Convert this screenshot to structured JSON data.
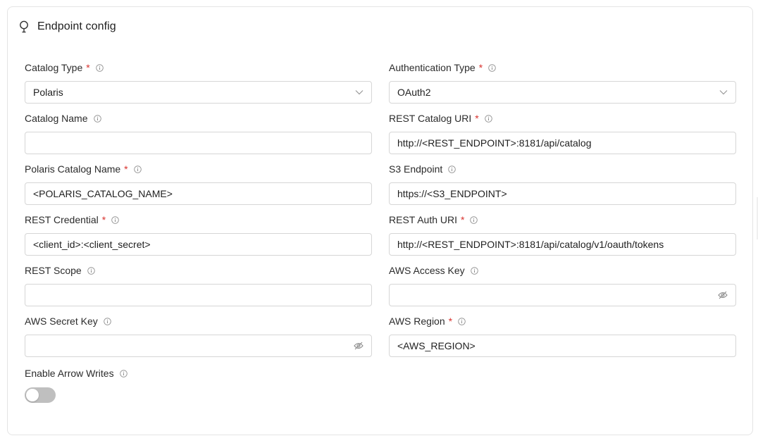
{
  "header": {
    "title": "Endpoint config",
    "icon": "lightbulb-icon"
  },
  "fields": {
    "catalog_type": {
      "label": "Catalog Type",
      "required": "*",
      "value": "Polaris"
    },
    "auth_type": {
      "label": "Authentication Type",
      "required": "*",
      "value": "OAuth2"
    },
    "catalog_name": {
      "label": "Catalog Name",
      "value": ""
    },
    "rest_catalog_uri": {
      "label": "REST Catalog URI",
      "required": "*",
      "value": "http://<REST_ENDPOINT>:8181/api/catalog"
    },
    "polaris_catalog_name": {
      "label": "Polaris Catalog Name",
      "required": "*",
      "value": "<POLARIS_CATALOG_NAME>"
    },
    "s3_endpoint": {
      "label": "S3 Endpoint",
      "value": "https://<S3_ENDPOINT>"
    },
    "rest_credential": {
      "label": "REST Credential",
      "required": "*",
      "value": "<client_id>:<client_secret>"
    },
    "rest_auth_uri": {
      "label": "REST Auth URI",
      "required": "*",
      "value": "http://<REST_ENDPOINT>:8181/api/catalog/v1/oauth/tokens"
    },
    "rest_scope": {
      "label": "REST Scope",
      "value": ""
    },
    "aws_access_key": {
      "label": "AWS Access Key",
      "value": ""
    },
    "aws_secret_key": {
      "label": "AWS Secret Key",
      "value": ""
    },
    "aws_region": {
      "label": "AWS Region",
      "required": "*",
      "value": "<AWS_REGION>"
    },
    "enable_arrow_writes": {
      "label": "Enable Arrow Writes",
      "enabled": false
    }
  },
  "colors": {
    "required": "#d8322e",
    "border": "#d6d6d6",
    "toggle_off": "#bfbfbf"
  }
}
